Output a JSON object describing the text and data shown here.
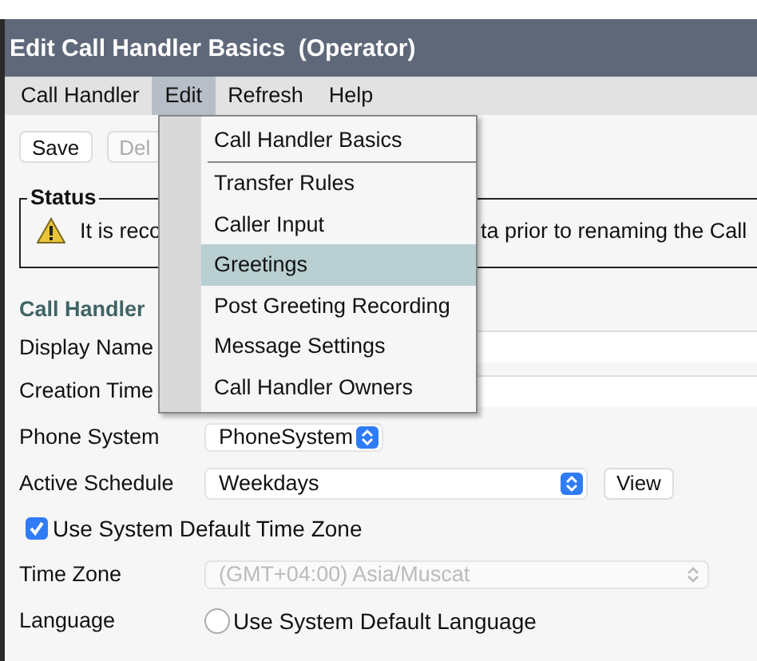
{
  "window": {
    "title": "Edit Call Handler Basics  (Operator)"
  },
  "menubar": [
    {
      "label": "Call Handler",
      "selected": false
    },
    {
      "label": "Edit",
      "selected": true
    },
    {
      "label": "Refresh",
      "selected": false
    },
    {
      "label": "Help",
      "selected": false
    }
  ],
  "toolbar": {
    "buttons": [
      {
        "label": "Save",
        "disabled": false
      },
      {
        "label": "Del",
        "disabled": true
      }
    ]
  },
  "status": {
    "legend": "Status",
    "message_parts": [
      "It is reco",
      "ta prior to renaming the Call"
    ]
  },
  "section_heading": "Call Handler",
  "fields": [
    {
      "kind": "text",
      "label": "Display Name"
    },
    {
      "kind": "text",
      "label": "Creation Time"
    },
    {
      "kind": "select",
      "label": "Phone System",
      "value": "PhoneSystem",
      "disabled": false
    },
    {
      "kind": "select",
      "label": "Active Schedule",
      "value": "Weekdays",
      "disabled": false,
      "button": "View"
    },
    {
      "kind": "checkbox",
      "label": "Use System Default Time Zone",
      "checked": true
    },
    {
      "kind": "select",
      "label": "Time Zone",
      "value": "(GMT+04:00) Asia/Muscat",
      "disabled": true
    },
    {
      "kind": "radio",
      "label": "Language",
      "option": "Use System Default Language",
      "selected": false
    }
  ],
  "dropdown_menu": {
    "items": [
      {
        "label": "Call Handler Basics",
        "selected": false,
        "separator_after": true
      },
      {
        "label": "Transfer Rules",
        "selected": false,
        "separator_after": false
      },
      {
        "label": "Caller Input",
        "selected": false,
        "separator_after": false
      },
      {
        "label": "Greetings",
        "selected": true,
        "separator_after": false
      },
      {
        "label": "Post Greeting Recording",
        "selected": false,
        "separator_after": false
      },
      {
        "label": "Message Settings",
        "selected": false,
        "separator_after": false
      },
      {
        "label": "Call Handler Owners",
        "selected": false,
        "separator_after": false
      }
    ]
  }
}
